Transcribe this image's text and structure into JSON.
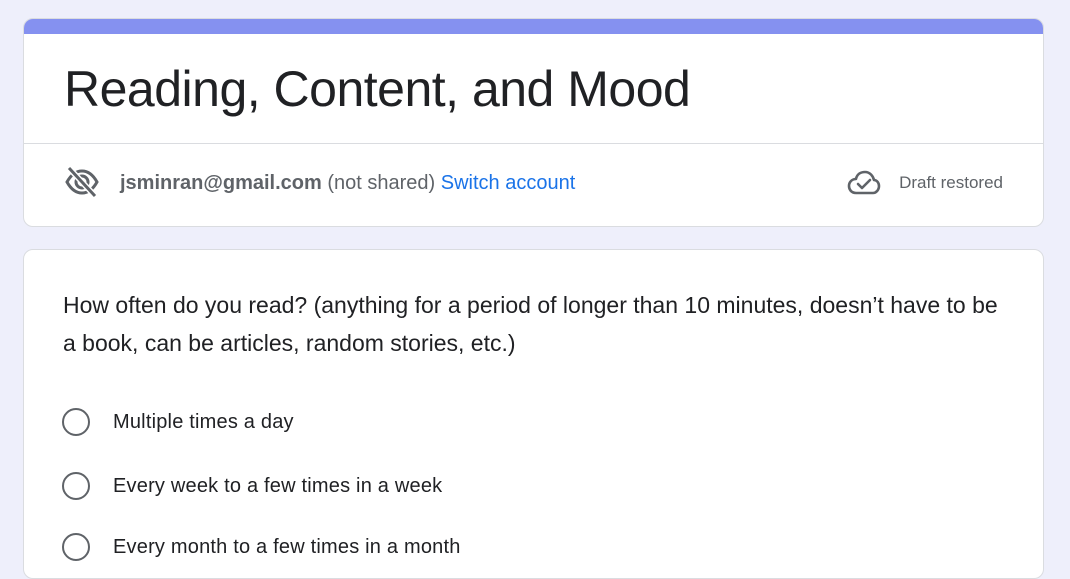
{
  "form": {
    "title": "Reading, Content, and Mood",
    "accent_color": "#8591f0"
  },
  "account": {
    "email": "jsminran@gmail.com",
    "sharing_status": "(not shared)",
    "switch_label": "Switch account",
    "draft_status": "Draft restored",
    "icons": {
      "visibility": "eye-off-icon",
      "cloud": "cloud-check-icon"
    }
  },
  "question": {
    "text": "How often do you read? (anything for a period of longer than 10 minutes, doesn’t have to be a book, can be articles, random stories, etc.)",
    "options": [
      {
        "label": "Multiple times a day"
      },
      {
        "label": "Every week to a few times in a week"
      },
      {
        "label": "Every month to a few times in a month"
      }
    ]
  }
}
